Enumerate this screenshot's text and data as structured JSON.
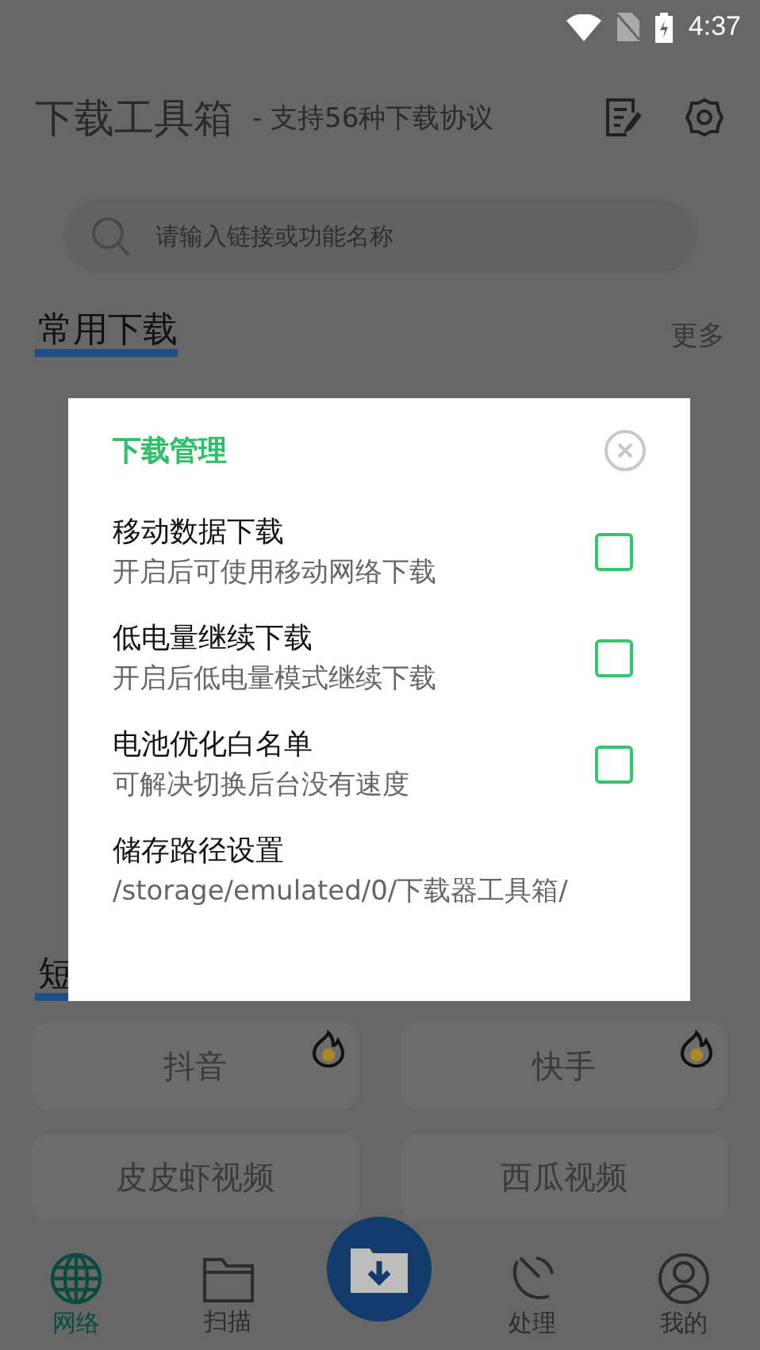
{
  "status_bar": {
    "time": "4:37"
  },
  "header": {
    "title": "下载工具箱",
    "subtitle": "- 支持56种下载协议"
  },
  "search": {
    "placeholder": "请输入链接或功能名称"
  },
  "common_section": {
    "title": "常用下载",
    "more": "更多"
  },
  "short_section": {
    "title": "短"
  },
  "platforms": [
    {
      "label": "抖音",
      "hot": true
    },
    {
      "label": "快手",
      "hot": true
    },
    {
      "label": "皮皮虾视频",
      "hot": false
    },
    {
      "label": "西瓜视频",
      "hot": false
    }
  ],
  "bottom_nav": [
    {
      "label": "网络",
      "kind": "globe",
      "selected": true
    },
    {
      "label": "扫描",
      "kind": "folder",
      "selected": false
    },
    {
      "kind": "fab"
    },
    {
      "label": "处理",
      "kind": "dish",
      "selected": false
    },
    {
      "label": "我的",
      "kind": "user",
      "selected": false
    }
  ],
  "dialog": {
    "title": "下载管理",
    "options": [
      {
        "kind": "checkbox",
        "label": "移动数据下载",
        "description": "开启后可使用移动网络下载",
        "checked": false
      },
      {
        "kind": "checkbox",
        "label": "低电量继续下载",
        "description": "开启后低电量模式继续下载",
        "checked": false
      },
      {
        "kind": "checkbox",
        "label": "电池优化白名单",
        "description": "可解决切换后台没有速度",
        "checked": false
      },
      {
        "kind": "path",
        "label": "储存路径设置",
        "description": "/storage/emulated/0/下载器工具箱/"
      }
    ]
  }
}
